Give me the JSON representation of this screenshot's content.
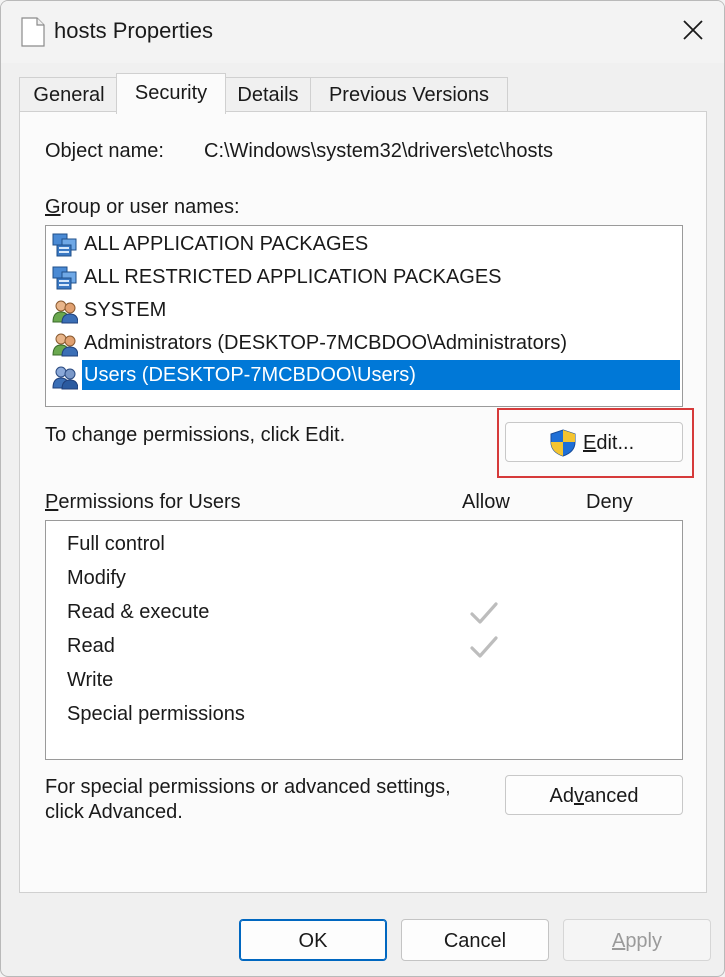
{
  "window": {
    "title": "hosts Properties"
  },
  "tabs": [
    {
      "label": "General",
      "active": false
    },
    {
      "label": "Security",
      "active": true
    },
    {
      "label": "Details",
      "active": false
    },
    {
      "label": "Previous Versions",
      "active": false
    }
  ],
  "security": {
    "object_name_label": "Object name:",
    "object_name_value": "C:\\Windows\\system32\\drivers\\etc\\hosts",
    "group_label_accel": "G",
    "group_label_rest": "roup or user names:",
    "groups": [
      {
        "name": "ALL APPLICATION PACKAGES",
        "icon": "app-packages-icon",
        "selected": false
      },
      {
        "name": "ALL RESTRICTED APPLICATION PACKAGES",
        "icon": "app-packages-icon",
        "selected": false
      },
      {
        "name": "SYSTEM",
        "icon": "users-group-icon",
        "selected": false
      },
      {
        "name": "Administrators (DESKTOP-7MCBDOO\\Administrators)",
        "icon": "users-group-icon",
        "selected": false
      },
      {
        "name": "Users (DESKTOP-7MCBDOO\\Users)",
        "icon": "users-group-icon",
        "selected": true
      }
    ],
    "change_hint": "To change permissions, click Edit.",
    "edit_accel": "E",
    "edit_rest": "dit...",
    "permissions_accel": "P",
    "permissions_rest": "ermissions for Users",
    "allow_header": "Allow",
    "deny_header": "Deny",
    "permissions": [
      {
        "name": "Full control",
        "allow": false,
        "deny": false
      },
      {
        "name": "Modify",
        "allow": false,
        "deny": false
      },
      {
        "name": "Read & execute",
        "allow": true,
        "deny": false
      },
      {
        "name": "Read",
        "allow": true,
        "deny": false
      },
      {
        "name": "Write",
        "allow": false,
        "deny": false
      },
      {
        "name": "Special permissions",
        "allow": false,
        "deny": false
      }
    ],
    "advanced_hint_line1": "For special permissions or advanced settings,",
    "advanced_hint_line2": "click Advanced.",
    "advanced_pre": "Ad",
    "advanced_accel": "v",
    "advanced_post": "anced"
  },
  "footer": {
    "ok": "OK",
    "cancel": "Cancel",
    "apply_accel": "A",
    "apply_rest": "pply"
  },
  "colors": {
    "selection": "#0078d7",
    "highlight_frame": "#d63a3a",
    "check_disabled": "#bdbdbd"
  }
}
